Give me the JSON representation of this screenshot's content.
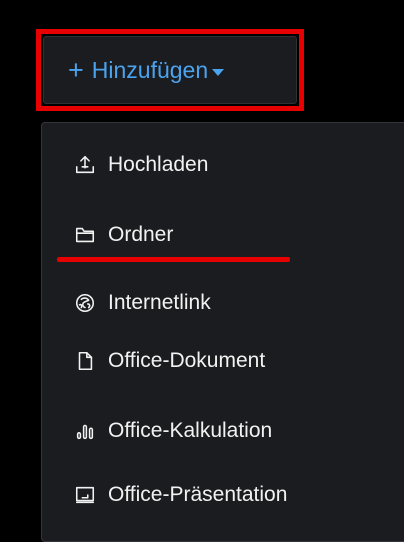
{
  "add_button": {
    "plus": "+",
    "label": "Hinzufügen"
  },
  "menu": {
    "items": [
      {
        "label": "Hochladen",
        "icon": "upload-icon"
      },
      {
        "label": "Ordner",
        "icon": "folder-icon"
      },
      {
        "label": "Internetlink",
        "icon": "link-globe-icon"
      },
      {
        "label": "Office-Dokument",
        "icon": "document-icon"
      },
      {
        "label": "Office-Kalkulation",
        "icon": "spreadsheet-icon"
      },
      {
        "label": "Office-Präsentation",
        "icon": "presentation-icon"
      }
    ]
  },
  "colors": {
    "background": "#000000",
    "menu_background": "#1b1c1f",
    "accent": "#4aa3ef",
    "text": "#f2f2f2",
    "annotation": "#e60000"
  }
}
